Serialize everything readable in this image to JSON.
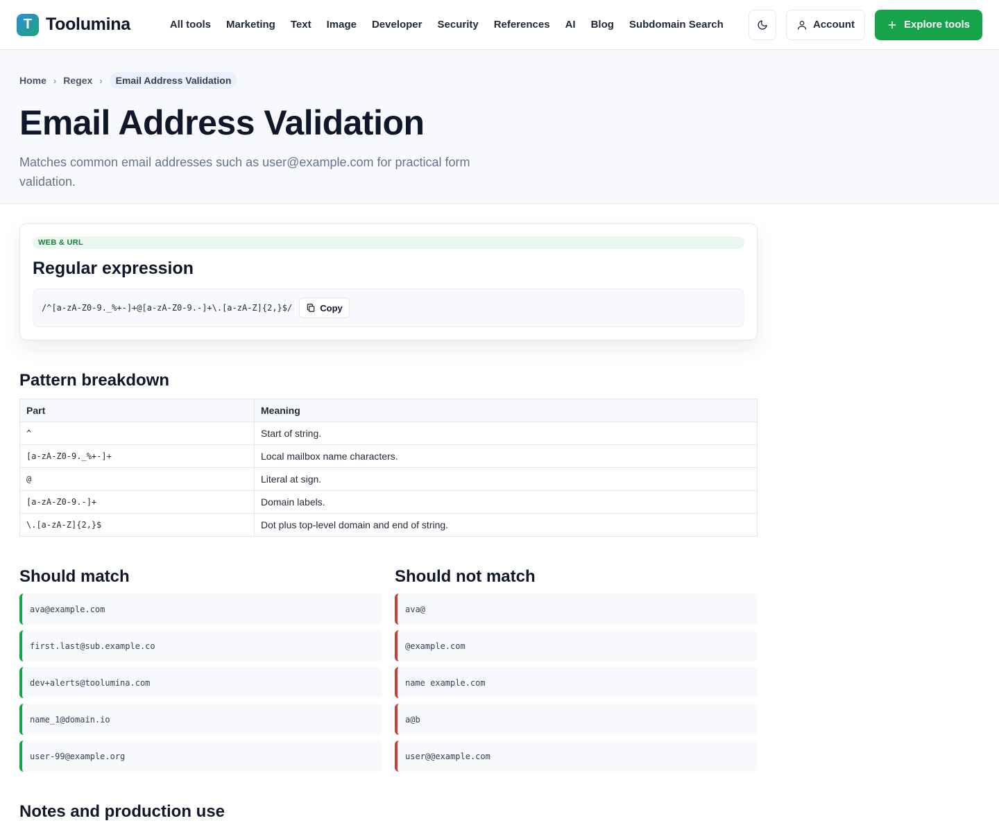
{
  "brand": {
    "logo_letter": "T",
    "name": "Toolumina"
  },
  "nav": [
    "All tools",
    "Marketing",
    "Text",
    "Image",
    "Developer",
    "Security",
    "References",
    "AI",
    "Blog",
    "Subdomain Search"
  ],
  "header": {
    "theme_icon": "moon-icon",
    "account_label": "Account",
    "explore_label": "Explore tools"
  },
  "breadcrumb": {
    "home": "Home",
    "section": "Regex",
    "current": "Email Address Validation"
  },
  "hero": {
    "title": "Email Address Validation",
    "description": "Matches common email addresses such as user@example.com for practical form validation."
  },
  "regex_card": {
    "badge": "WEB & URL",
    "title": "Regular expression",
    "pattern": "/^[a-zA-Z0-9._%+-]+@[a-zA-Z0-9.-]+\\.[a-zA-Z]{2,}$/",
    "copy_label": "Copy"
  },
  "breakdown": {
    "title": "Pattern breakdown",
    "columns": [
      "Part",
      "Meaning"
    ],
    "rows": [
      {
        "part": "^",
        "meaning": "Start of string."
      },
      {
        "part": "[a-zA-Z0-9._%+-]+",
        "meaning": "Local mailbox name characters."
      },
      {
        "part": "@",
        "meaning": "Literal at sign."
      },
      {
        "part": "[a-zA-Z0-9.-]+",
        "meaning": "Domain labels."
      },
      {
        "part": "\\.[a-zA-Z]{2,}$",
        "meaning": "Dot plus top-level domain and end of string."
      }
    ]
  },
  "should_match": {
    "title": "Should match",
    "items": [
      "ava@example.com",
      "first.last@sub.example.co",
      "dev+alerts@toolumina.com",
      "name_1@domain.io",
      "user-99@example.org"
    ]
  },
  "should_not_match": {
    "title": "Should not match",
    "items": [
      "ava@",
      "@example.com",
      "name example.com",
      "a@b",
      "user@@example.com"
    ]
  },
  "notes": {
    "title": "Notes and production use"
  },
  "colors": {
    "accent_green": "#16a34a",
    "error_red": "#c2413b",
    "logo_blue": "#2b8fd6"
  }
}
